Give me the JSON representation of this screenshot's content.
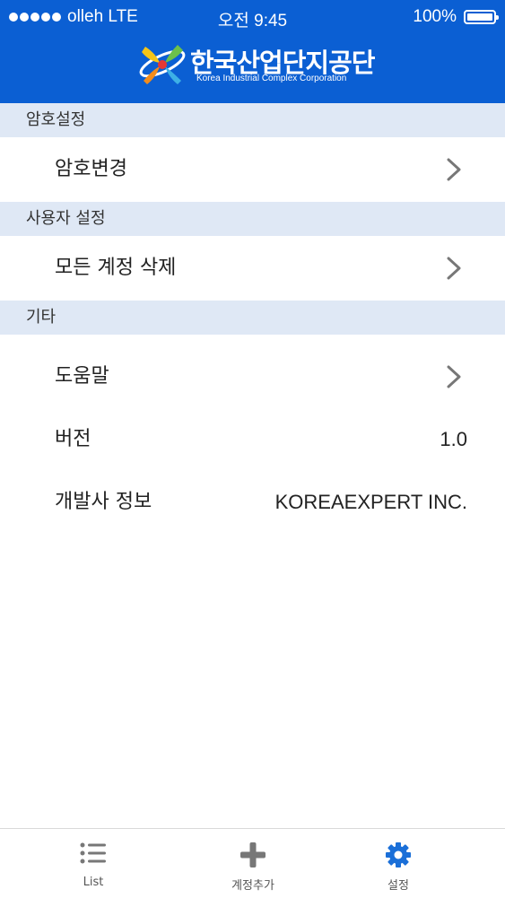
{
  "status_bar": {
    "carrier": "olleh LTE",
    "time": "오전 9:45",
    "battery": "100%"
  },
  "header": {
    "logo_title": "한국산업단지공단",
    "logo_subtitle": "Korea Industrial Complex Corporation"
  },
  "sections": {
    "password": {
      "title": "암호설정",
      "change_password": "암호변경"
    },
    "user": {
      "title": "사용자 설정",
      "delete_all": "모든 계정 삭제"
    },
    "etc": {
      "title": "기타",
      "help": "도움말",
      "version_label": "버전",
      "version_value": "1.0",
      "developer_label": "개발사 정보",
      "developer_value": "KOREAEXPERT INC."
    }
  },
  "tab_bar": {
    "list": "List",
    "add_account": "계정추가",
    "settings": "설정"
  },
  "colors": {
    "header_bg": "#0b5fd3",
    "section_bg": "#dfe8f5",
    "active_tab": "#1a6fd8"
  }
}
